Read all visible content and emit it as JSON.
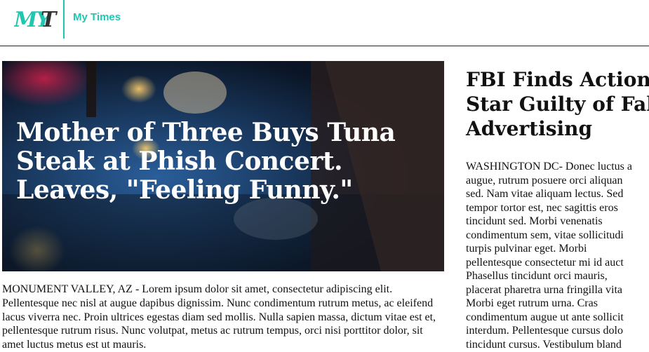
{
  "header": {
    "logo_text": "MYT",
    "brand_name": "My Times"
  },
  "featured_article": {
    "headline": "Mother of Three Buys Tuna Steak at Phish Concert. Leaves, \"Feeling Funny.\"",
    "body": "MONUMENT VALLEY, AZ - Lorem ipsum dolor sit amet, consectetur adipiscing elit. Pellentesque nec nisl at augue dapibus dignissim. Nunc condimentum rutrum metus, ac eleifend lacus viverra nec. Proin ultrices egestas diam sed mollis. Nulla sapien massa, dictum vitae est et, pellentesque rutrum risus. Nunc volutpat, metus ac rutrum tempus, orci nisi porttitor dolor, sit amet luctus metus est ut mauris."
  },
  "side_article": {
    "headline": "FBI Finds Action\nStar Guilty of Fal\nAdvertising",
    "body": "WASHINGTON DC- Donec luctus a\naugue, rutrum posuere orci aliquan\nsed. Nam vitae aliquam lectus. Sed\ntempor tortor est, nec sagittis eros\ntincidunt sed. Morbi venenatis\ncondimentum sem, vitae sollicitudi\nturpis pulvinar eget. Morbi\npellentesque consectetur mi id auct\nPhasellus tincidunt orci mauris,\nplacerat pharetra urna fringilla vita\nMorbi eget rutrum urna. Cras\ncondimentum augue ut ante sollicit\ninterdum. Pellentesque cursus dolo\ntincidunt cursus. Vestibulum bland"
  },
  "colors": {
    "brand_teal": "#1fc7b0",
    "logo_dark": "#333333"
  }
}
